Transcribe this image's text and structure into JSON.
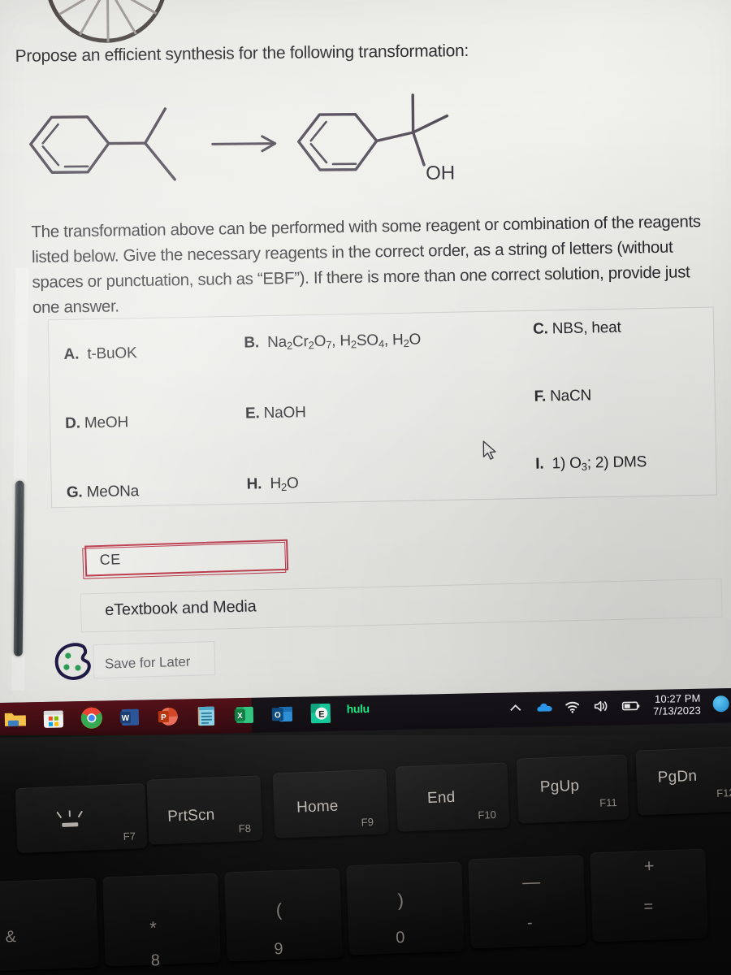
{
  "question": {
    "prompt": "Propose an efficient synthesis for the following transformation:",
    "paragraph": "The transformation above can be performed with some reagent or combination of the reagents listed below. Give the necessary reagents in the correct order, as a string of letters (without spaces or punctuation, such as “EBF”). If there is more than one correct solution, provide just one answer."
  },
  "scheme": {
    "reactant_name": "isopropylbenzene",
    "product_name": "2-phenyl-2-propanol",
    "product_label": "OH",
    "arrow": "reaction-arrow"
  },
  "reagents": {
    "rows": [
      [
        {
          "letter": "A.",
          "text": "t-BuOK"
        },
        {
          "letter": "B.",
          "text": "Na2Cr2O7, H2SO4, H2O"
        },
        {
          "letter": "C.",
          "text": "NBS, heat"
        }
      ],
      [
        {
          "letter": "D.",
          "text": "MeOH"
        },
        {
          "letter": "E.",
          "text": "NaOH"
        },
        {
          "letter": "F.",
          "text": "NaCN"
        }
      ],
      [
        {
          "letter": "G.",
          "text": "MeONa"
        },
        {
          "letter": "H.",
          "text": "H2O"
        },
        {
          "letter": "I.",
          "text": "1) O3; 2) DMS"
        }
      ]
    ]
  },
  "answer": {
    "value": "CE",
    "placeholder": "",
    "border_color": "#c0394b"
  },
  "actions": {
    "etextbook_label": "eTextbook and Media",
    "save_for_later_label": "Save for Later",
    "cookie_icon": "cookie-icon"
  },
  "taskbar": {
    "apps": [
      {
        "name": "file-explorer",
        "label": ""
      },
      {
        "name": "microsoft-store",
        "label": ""
      },
      {
        "name": "google-chrome",
        "label": ""
      },
      {
        "name": "microsoft-word",
        "label": "W"
      },
      {
        "name": "microsoft-powerpoint",
        "label": "P"
      },
      {
        "name": "notepad",
        "label": ""
      },
      {
        "name": "microsoft-excel",
        "label": "X"
      },
      {
        "name": "microsoft-outlook",
        "label": "O"
      },
      {
        "name": "evernote",
        "label": "E"
      },
      {
        "name": "hulu",
        "label": "hulu"
      }
    ],
    "tray": {
      "chevron": "⌃",
      "onedrive": "onedrive-cloud-icon",
      "wifi": "wifi-icon",
      "volume": "volume-icon",
      "battery": "battery-icon",
      "time": "10:27 PM",
      "date": "7/13/2023"
    }
  },
  "keyboard": {
    "function_keys": [
      {
        "main": "",
        "sub": "F7",
        "icon": "keyboard-backlight-icon"
      },
      {
        "main": "PrtScn",
        "sub": "F8",
        "icon": ""
      },
      {
        "main": "Home",
        "sub": "F9",
        "icon": ""
      },
      {
        "main": "End",
        "sub": "F10",
        "icon": ""
      },
      {
        "main": "PgUp",
        "sub": "F11",
        "icon": ""
      },
      {
        "main": "PgDn",
        "sub": "F12",
        "icon": ""
      }
    ],
    "number_keys": [
      {
        "top": "",
        "bot": "&"
      },
      {
        "top": "*",
        "bot": "8"
      },
      {
        "top": "(",
        "bot": "9"
      },
      {
        "top": ")",
        "bot": "0"
      },
      {
        "top": "—",
        "bot": "-"
      },
      {
        "top": "+",
        "bot": "="
      }
    ]
  }
}
